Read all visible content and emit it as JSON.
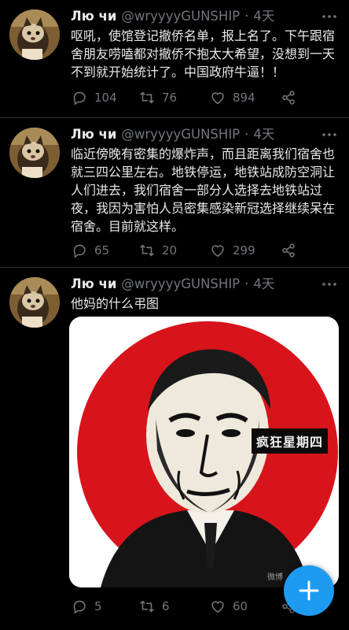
{
  "tweets": [
    {
      "author_name": "Лю чи",
      "handle": "@wryyyyGUNSHIP",
      "separator": "·",
      "time": "4天",
      "text": "呕吼，使馆登记撤侨名单，报上名了。下午跟宿舍朋友唠嗑都对撤侨不抱太大希望，没想到一天不到就开始统计了。中国政府牛逼！！",
      "replies": "104",
      "retweets": "76",
      "likes": "894"
    },
    {
      "author_name": "Лю чи",
      "handle": "@wryyyyGUNSHIP",
      "separator": "·",
      "time": "4天",
      "text": "临近傍晚有密集的爆炸声，而且距离我们宿舍也就三四公里左右。地铁停运，地铁站成防空洞让人们进去，我们宿舍一部分人选择去地铁站过夜，我因为害怕人员密集感染新冠选择继续呆在宿舍。目前就这样。",
      "replies": "65",
      "retweets": "20",
      "likes": "299"
    },
    {
      "author_name": "Лю чи",
      "handle": "@wryyyyGUNSHIP",
      "separator": "·",
      "time": "4天",
      "text": "他妈的什么弔图",
      "media_caption": "疯狂星期四",
      "media_watermark": "微博",
      "replies": "5",
      "retweets": "6",
      "likes": "60"
    }
  ],
  "icons": {
    "reply": "reply-icon",
    "retweet": "retweet-icon",
    "like": "heart-icon",
    "share": "share-icon",
    "more": "more-dots-icon",
    "compose": "plus-icon"
  },
  "colors": {
    "background": "#000000",
    "text_primary": "#e7e9ea",
    "text_secondary": "#71767b",
    "accent": "#1d9bf0",
    "divider": "#2f3336",
    "media_circle": "#d7141b"
  }
}
